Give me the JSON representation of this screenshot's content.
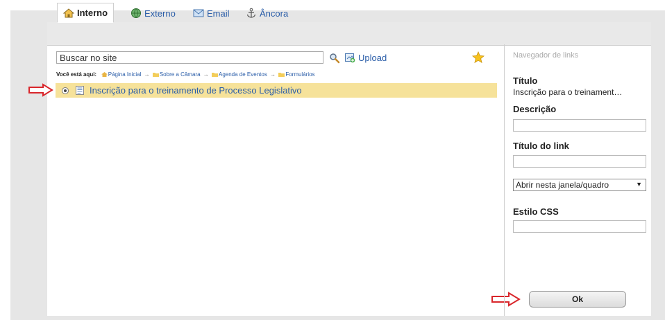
{
  "tabs": [
    {
      "label": "Interno",
      "icon": "home-icon",
      "active": true
    },
    {
      "label": "Externo",
      "icon": "globe-icon",
      "active": false
    },
    {
      "label": "Email",
      "icon": "email-icon",
      "active": false
    },
    {
      "label": "Âncora",
      "icon": "anchor-icon",
      "active": false
    }
  ],
  "search": {
    "value": "Buscar no site"
  },
  "upload_label": "Upload",
  "breadcrumb": {
    "lead": "Você está aqui:",
    "items": [
      "Página Inicial",
      "Sobre a Câmara",
      "Agenda de Eventos",
      "Formulários"
    ],
    "separator": "→"
  },
  "result": {
    "label": "Inscrição para o treinamento de Processo Legislativo"
  },
  "side": {
    "nav_title": "Navegador de links",
    "titulo_label": "Título",
    "titulo_value": "Inscrição para o treinament…",
    "descricao_label": "Descrição",
    "titulo_link_label": "Título do link",
    "target_selected": "Abrir nesta janela/quadro",
    "estilo_label": "Estilo CSS",
    "ok_label": "Ok"
  },
  "colors": {
    "accent": "#2a5da8",
    "highlight": "#f6e29a",
    "red_arrow": "#d9262b"
  }
}
